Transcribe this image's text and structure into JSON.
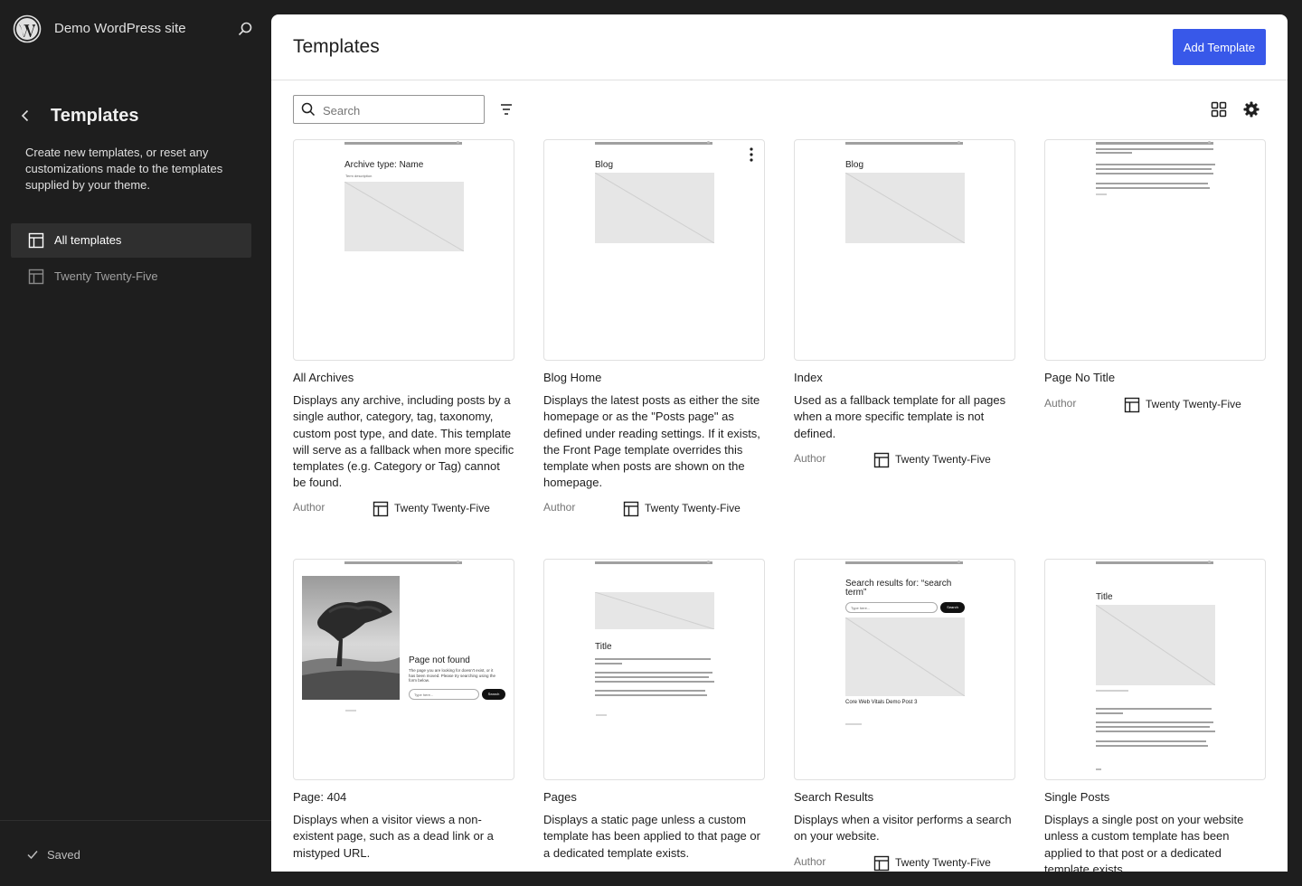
{
  "site": {
    "name": "Demo WordPress site"
  },
  "sidebar": {
    "title": "Templates",
    "description": "Create new templates, or reset any customizations made to the templates supplied by your theme.",
    "items": [
      {
        "label": "All templates",
        "active": true
      },
      {
        "label": "Twenty Twenty-Five",
        "active": false
      }
    ],
    "footer_status": "Saved"
  },
  "main": {
    "title": "Templates",
    "add_button": "Add Template",
    "search_placeholder": "Search",
    "meta_author_label": "Author",
    "meta_theme_label": "Twenty Twenty-Five"
  },
  "templates": [
    {
      "title": "All Archives",
      "description": "Displays any archive, including posts by a single author, category, tag, taxonomy, custom post type, and date. This template will serve as a fallback when more specific templates (e.g. Category or Tag) cannot be found.",
      "preview_heading": "Archive type: Name",
      "preview_sub": "Term description"
    },
    {
      "title": "Blog Home",
      "description": "Displays the latest posts as either the site homepage or as the \"Posts page\" as defined under reading settings. If it exists, the Front Page template overrides this template when posts are shown on the homepage.",
      "preview_heading": "Blog"
    },
    {
      "title": "Index",
      "description": "Used as a fallback template for all pages when a more specific template is not defined.",
      "preview_heading": "Blog"
    },
    {
      "title": "Page No Title",
      "description": ""
    },
    {
      "title": "Page: 404",
      "description": "Displays when a visitor views a non-existent page, such as a dead link or a mistyped URL.",
      "preview_heading": "Page not found",
      "preview_body": "The page you are looking for doesn't exist, or it has been moved. Please try searching using the form below.",
      "preview_search": "Search",
      "preview_input": "Type here..."
    },
    {
      "title": "Pages",
      "description": "Displays a static page unless a custom template has been applied to that page or a dedicated template exists.",
      "preview_heading": "Title"
    },
    {
      "title": "Search Results",
      "description": "Displays when a visitor performs a search on your website.",
      "preview_heading": "Search results for: “search term”",
      "preview_search": "Search",
      "preview_input": "Type here...",
      "preview_post": "Core Web Vitals Demo Post 3"
    },
    {
      "title": "Single Posts",
      "description": "Displays a single post on your website unless a custom template has been applied to that post or a dedicated template exists.",
      "preview_heading": "Title"
    }
  ]
}
